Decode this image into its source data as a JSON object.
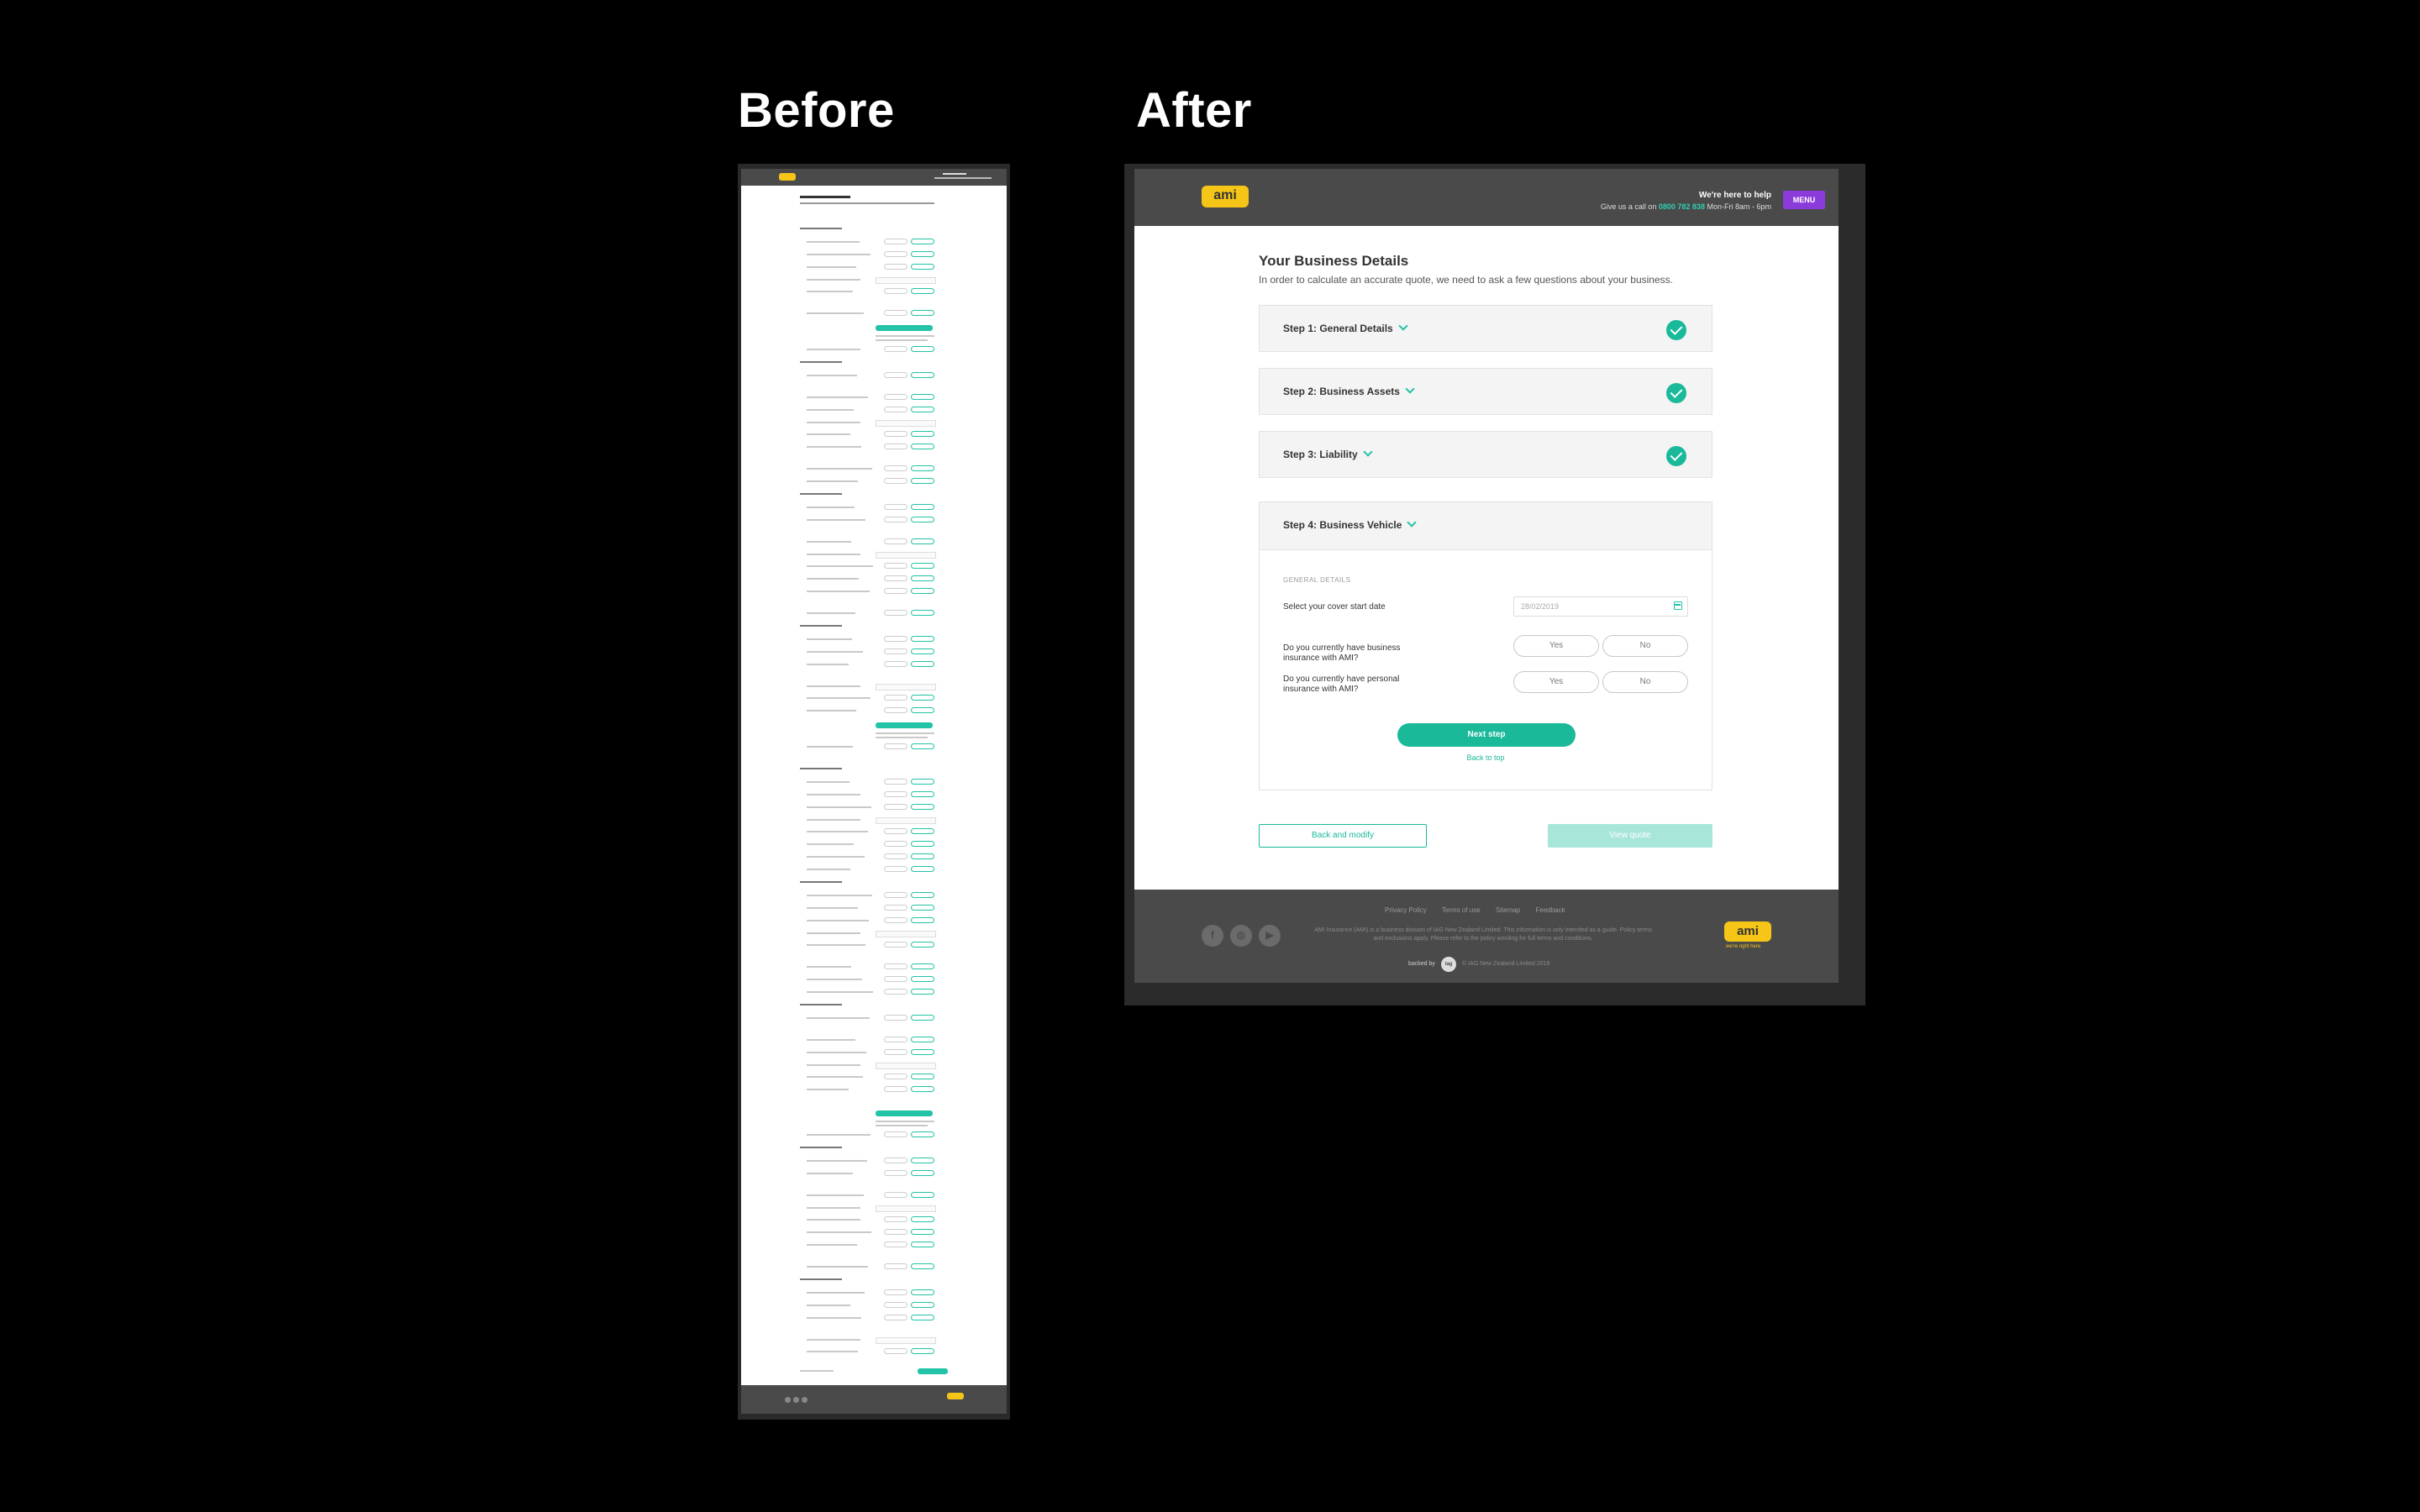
{
  "labels": {
    "before": "Before",
    "after": "After"
  },
  "header": {
    "logo": "ami",
    "help_title": "We're here to help",
    "call_prefix": "Give us a call on",
    "phone": "0800 782 838",
    "hours": "Mon-Fri 8am - 6pm",
    "menu": "MENU"
  },
  "page": {
    "title": "Your Business Details",
    "description": "In order to calculate an accurate quote, we need to ask a few questions about your business."
  },
  "steps": [
    {
      "label": "Step 1: General Details",
      "complete": true
    },
    {
      "label": "Step 2: Business Assets",
      "complete": true
    },
    {
      "label": "Step 3: Liability",
      "complete": true
    },
    {
      "label": "Step 4: Business Vehicle",
      "complete": false
    }
  ],
  "form": {
    "section_label": "GENERAL DETAILS",
    "cover_date_label": "Select your cover start date",
    "cover_date_value": "28/02/2019",
    "q_business": "Do you currently have business insurance with AMI?",
    "q_personal": "Do you currently have personal insurance with AMI?",
    "yes": "Yes",
    "no": "No",
    "next_step": "Next step",
    "back_to_top": "Back to top"
  },
  "actions": {
    "back_modify": "Back and modify",
    "view_quote": "View quote"
  },
  "footer": {
    "links": [
      "Privacy Policy",
      "Terms of use",
      "Sitemap",
      "Feedback"
    ],
    "legal": "AMI Insurance (AMI) is a business division of IAG New Zealand Limited. This information is only intended as a guide. Policy terms and exclusions apply. Please refer to the policy wording for full terms and conditions.",
    "backed_by": "backed by",
    "iag": "iag",
    "copyright": "© IAG New Zealand Limited 2018",
    "tagline": "we're right here",
    "social_icons": [
      "facebook-icon",
      "instagram-icon",
      "youtube-icon"
    ]
  },
  "colors": {
    "accent": "#19b99a",
    "brand_yellow": "#f5c518",
    "menu_purple": "#8b3bd9",
    "header_grey": "#4a4a4a"
  }
}
